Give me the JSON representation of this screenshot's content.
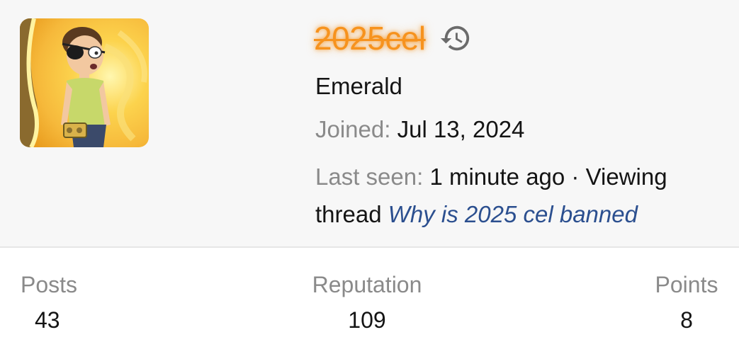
{
  "profile": {
    "username": "2025cel",
    "rank": "Emerald",
    "joined_label": "Joined:",
    "joined_value": "Jul 13, 2024",
    "last_seen_label": "Last seen:",
    "last_seen_value": "1 minute ago · Viewing thread",
    "last_seen_thread": "Why is 2025 cel banned",
    "username_color": "#f7931e",
    "link_color": "#2b4f8f",
    "avatar_icon": "avatar-image",
    "history_icon": "history-icon"
  },
  "stats": {
    "posts_label": "Posts",
    "posts_value": "43",
    "reputation_label": "Reputation",
    "reputation_value": "109",
    "points_label": "Points",
    "points_value": "8"
  }
}
